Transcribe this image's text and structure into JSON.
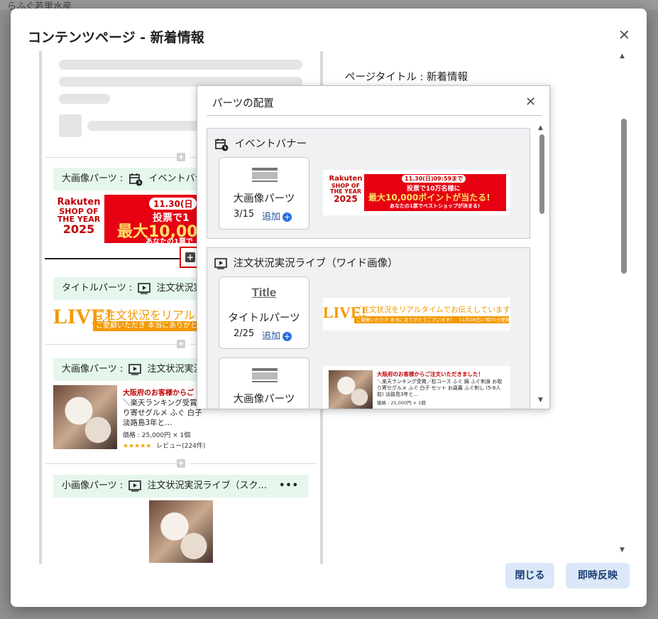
{
  "background": {
    "fragment": "らふぐ若里水産"
  },
  "modal": {
    "title": "コンテンツページ - 新着情報",
    "close_glyph": "✕",
    "page_title_label": "ページタイトル : 新着情報",
    "buttons": {
      "close": "閉じる",
      "apply": "即時反映"
    }
  },
  "preview": {
    "parts": [
      {
        "type_label": "大画像パーツ :",
        "content_label": "イベントバナー",
        "icon": "calendar-clock-icon"
      },
      {
        "type_label": "タイトルパーツ :",
        "content_label": "注文状況実況ライブ（ワイド画像）",
        "icon": "live-play-icon"
      },
      {
        "type_label": "大画像パーツ :",
        "content_label": "注文状況実況ライブ（ワイド画像）",
        "icon": "live-play-icon"
      },
      {
        "type_label": "小画像パーツ :",
        "content_label": "注文状況実況ライブ（スク...",
        "icon": "live-play-icon",
        "more": "•••"
      }
    ],
    "rakuten_banner": {
      "logo_line1": "Rakuten",
      "logo_line2": "SHOP OF",
      "logo_line3": "THE YEAR",
      "logo_line4": "2025",
      "date_text": "11.30(日",
      "vote_text": "投票で1",
      "big_text": "最大10,000",
      "sub_text": "あなたの1票で"
    },
    "live_banner": {
      "live": "LIVE!",
      "text": "ご注文状況をリアルタ",
      "bar": "ご愛顧いただき 本当にありがとうご"
    },
    "product": {
      "title": "大阪府のお客様からご",
      "desc": "＼楽天ランキング受賞\nり寄せグルメ ふぐ 白子\n淡路島3年と…",
      "price": "価格 : 25,000円 × 1個",
      "stars": "★★★★★",
      "review": "レビュー(224件)"
    }
  },
  "popup": {
    "title": "パーツの配置",
    "close_glyph": "✕",
    "sections": [
      {
        "title": "イベントバナー",
        "icon": "calendar-clock-icon",
        "cards": [
          {
            "name": "大画像パーツ",
            "count": "3/15",
            "add": "追加",
            "icon": "image-placeholder-icon"
          }
        ],
        "banner": {
          "logo_line1": "Rakuten",
          "logo_line2": "SHOP OF",
          "logo_line3": "THE YEAR",
          "logo_line4": "2025",
          "date_text": "11.30(日)09:59まで",
          "vote_text": "投票で10万名様に",
          "big_text": "最大10,000ポイントが当たる!",
          "sub_text": "あなたの1票でベストショップが決まる!"
        }
      },
      {
        "title": "注文状況実況ライブ（ワイド画像）",
        "icon": "live-play-icon",
        "cards": [
          {
            "name": "タイトルパーツ",
            "count": "2/25",
            "add": "追加",
            "icon": "title-text-icon",
            "icon_text": "Title"
          },
          {
            "name": "大画像パーツ",
            "count": "",
            "add": "",
            "icon": "image-placeholder-icon"
          }
        ],
        "live_banner": {
          "live": "LIVE!",
          "text": "ご注文状況をリアルタイムでお伝えしています",
          "bar": "ご愛顧いただき 本当にありがとうございます！",
          "updated": "11月28日17時05分更新"
        },
        "product": {
          "title": "大阪府のお客様からご注文いただきました！",
          "desc": "＼楽天ランキング受賞／松コース ふぐ 鍋 ふぐ刺身 お取り寄せグルメ ふぐ 白子 セット お歳暮 ふぐ刺し (5-6人前) 淡路島3年と…",
          "price": "価格 : 25,000円 × 1個"
        }
      }
    ]
  },
  "colors": {
    "accent_green": "#e5f7ec",
    "button_bg": "#dbe8f7",
    "add_blue": "#2a6fdb",
    "rakuten_red": "#e60012",
    "live_orange": "#f39800",
    "highlight_red": "#dd0000"
  }
}
